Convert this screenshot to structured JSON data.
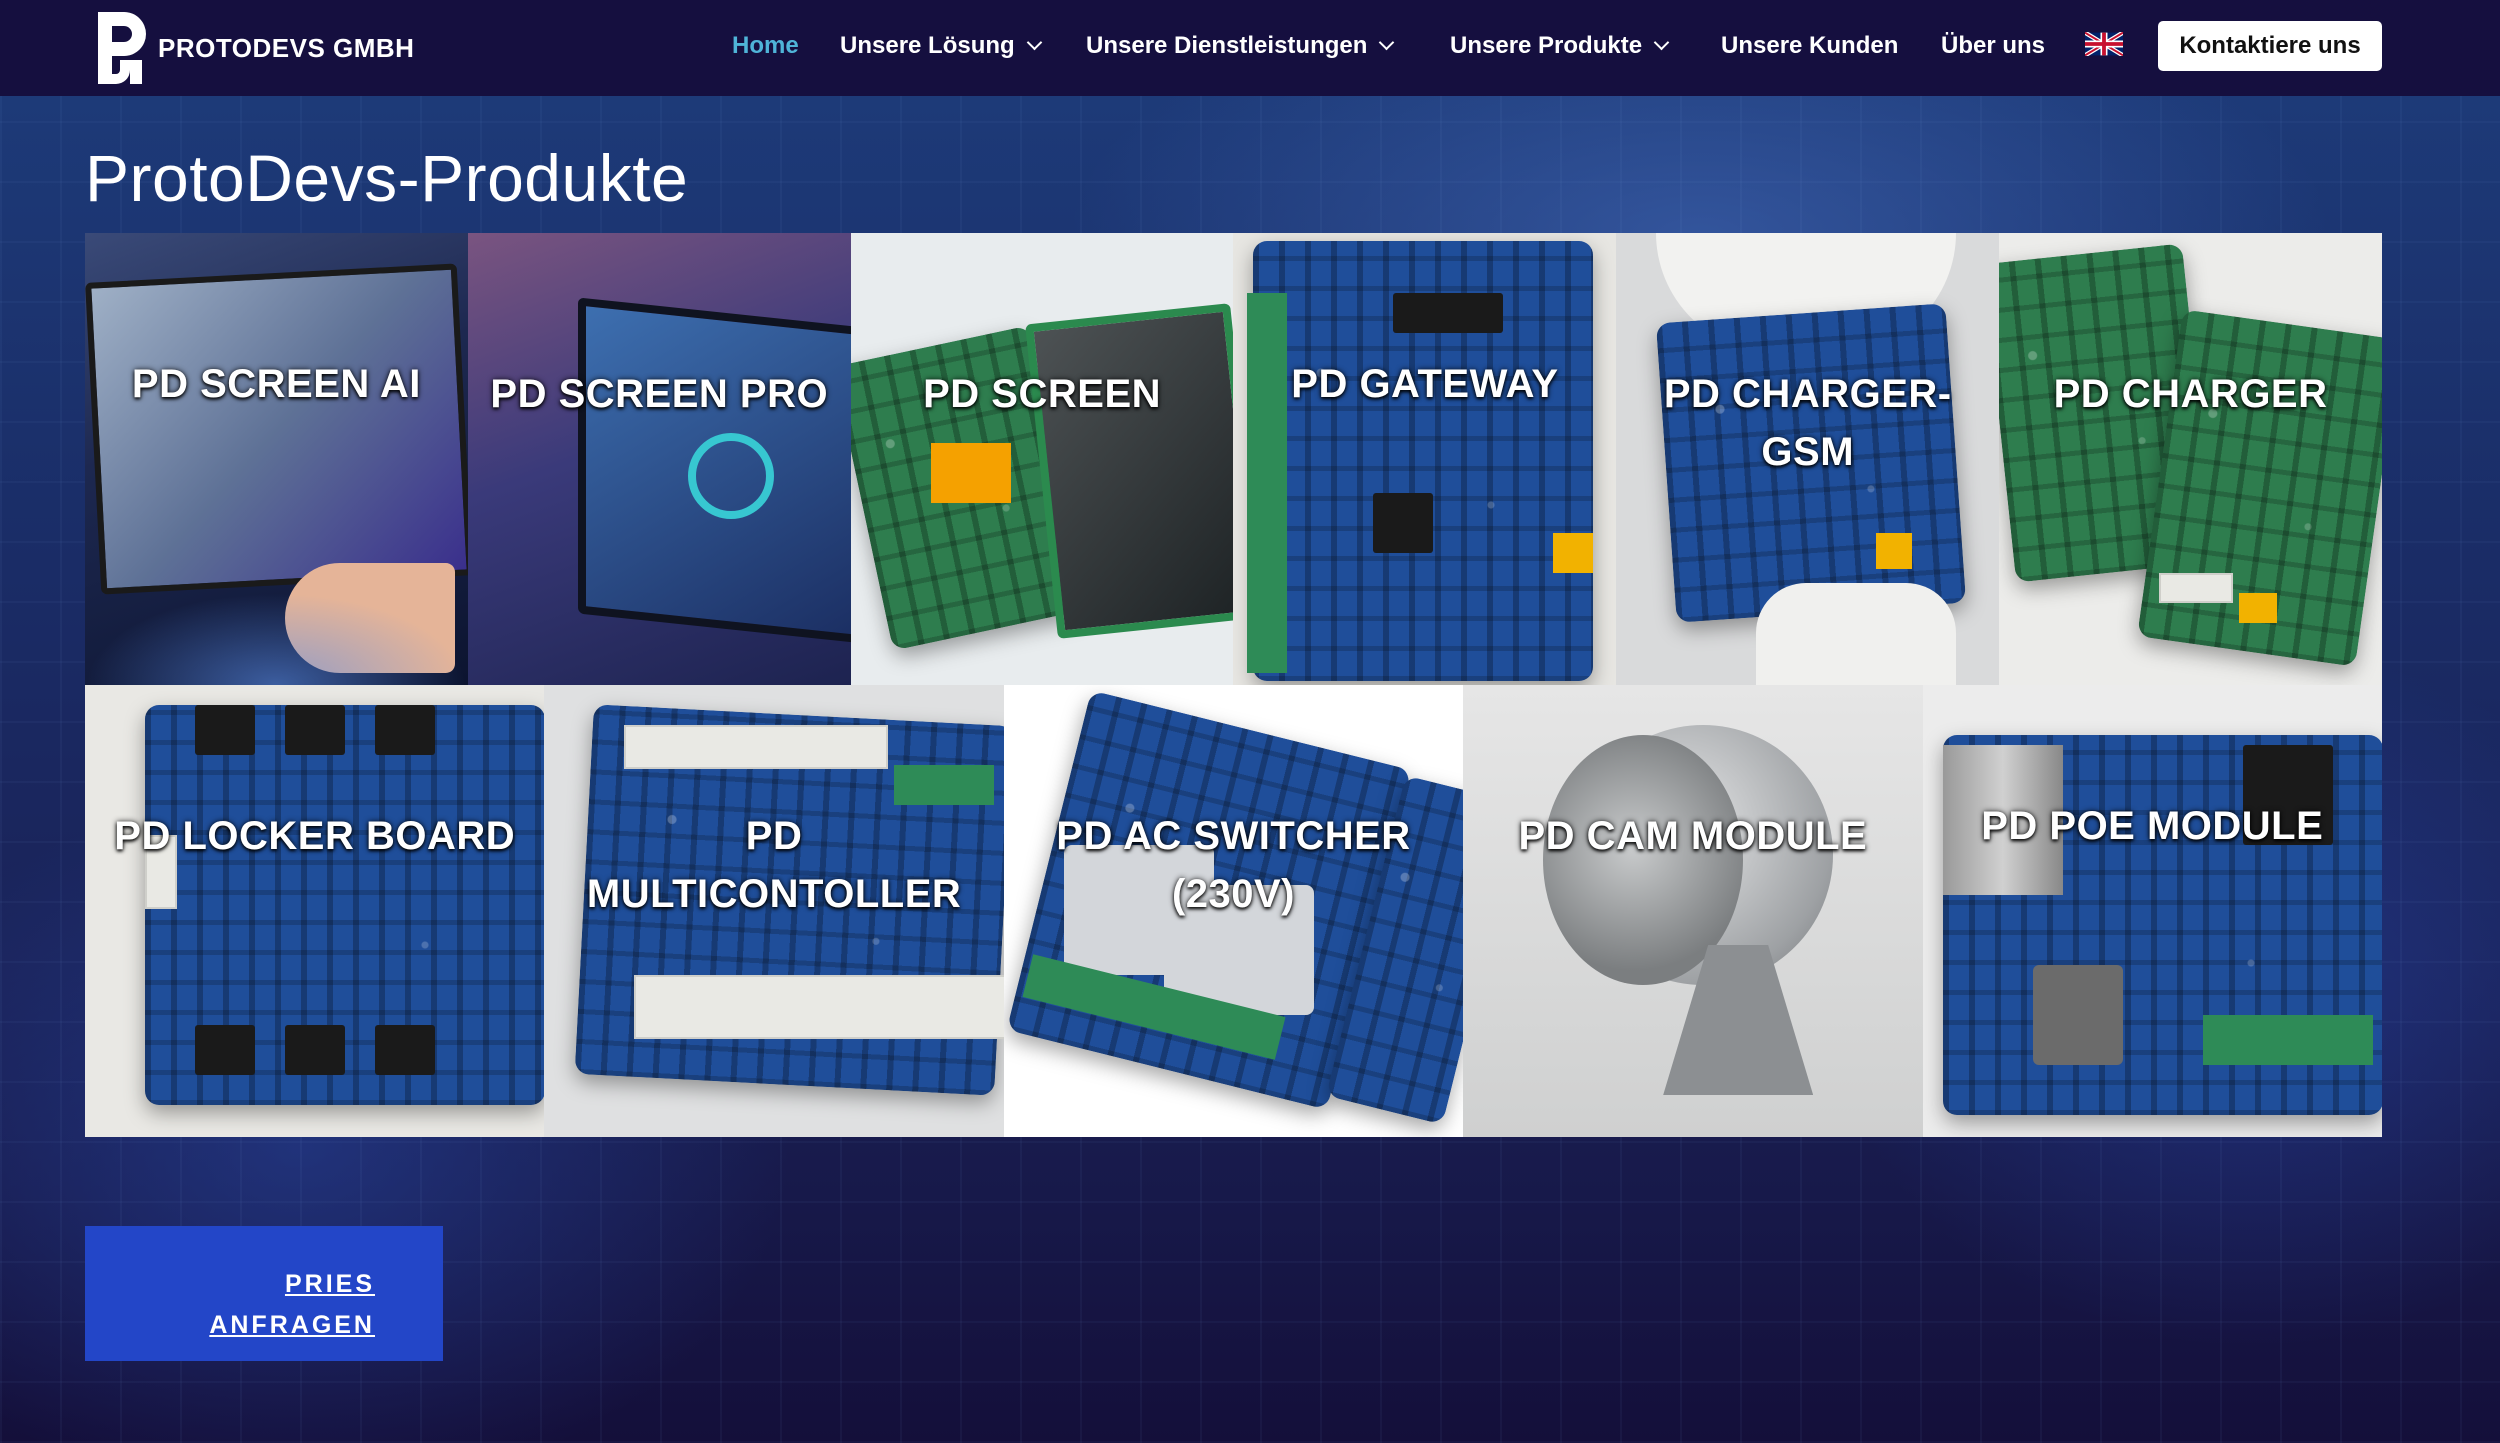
{
  "header": {
    "brand": "PROTODEVS GMBH",
    "nav": [
      {
        "label": "Home",
        "active": true,
        "dropdown": false
      },
      {
        "label": "Unsere Lösung",
        "active": false,
        "dropdown": true
      },
      {
        "label": "Unsere Dienstleistungen",
        "active": false,
        "dropdown": true
      },
      {
        "label": "Unsere Produkte",
        "active": false,
        "dropdown": true
      },
      {
        "label": "Unsere Kunden",
        "active": false,
        "dropdown": false
      },
      {
        "label": "Über uns",
        "active": false,
        "dropdown": false
      }
    ],
    "language_icon": "uk-flag-icon",
    "cta_label": "Kontaktiere uns"
  },
  "main": {
    "title": "ProtoDevs-Produkte",
    "products_row1": [
      {
        "label": "PD SCREEN AI"
      },
      {
        "label": "PD SCREEN PRO"
      },
      {
        "label": "PD SCREEN"
      },
      {
        "label": "PD GATEWAY"
      },
      {
        "label": "PD CHARGER-GSM"
      },
      {
        "label": "PD CHARGER"
      }
    ],
    "products_row2": [
      {
        "label": "PD LOCKER BOARD"
      },
      {
        "label": "PD MULTICONTOLLER"
      },
      {
        "label": "PD AC SWITCHER (230V)"
      },
      {
        "label": "PD CAM MODULE"
      },
      {
        "label": "PD POE MODULE"
      }
    ],
    "quote_button": "PRIES ANFRAGEN"
  },
  "colors": {
    "header_bg": "#150f3f",
    "nav_active": "#4fb4d8",
    "button_blue": "#2346c8",
    "cta_bg": "#ffffff"
  }
}
